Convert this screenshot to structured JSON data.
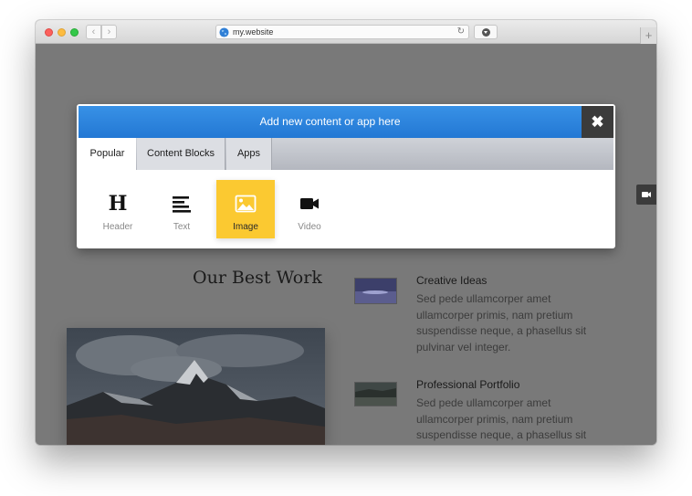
{
  "browser": {
    "url": "my.website",
    "back_label": "‹",
    "forward_label": "›",
    "newtab_label": "+"
  },
  "panel": {
    "title": "Add new content or app here",
    "close_label": "✖",
    "tabs": [
      {
        "label": "Popular",
        "active": true
      },
      {
        "label": "Content Blocks",
        "active": false
      },
      {
        "label": "Apps",
        "active": false
      }
    ],
    "items": [
      {
        "label": "Header",
        "icon": "header-icon"
      },
      {
        "label": "Text",
        "icon": "text-icon"
      },
      {
        "label": "Image",
        "icon": "image-icon",
        "selected": true
      },
      {
        "label": "Video",
        "icon": "video-icon"
      }
    ]
  },
  "page": {
    "section_title": "Our Best Work",
    "features": [
      {
        "title": "Creative Ideas",
        "body": "Sed pede ullamcorper amet ullamcorper primis, nam pretium suspendisse neque, a phasellus sit pulvinar vel integer."
      },
      {
        "title": "Professional Portfolio",
        "body": "Sed pede ullamcorper amet ullamcorper primis, nam pretium suspendisse neque, a phasellus sit pulvinar vel integer."
      }
    ]
  },
  "colors": {
    "accent_blue": "#2a82dc",
    "selected_yellow": "#fbc931",
    "overlay_gray": "#797979"
  }
}
